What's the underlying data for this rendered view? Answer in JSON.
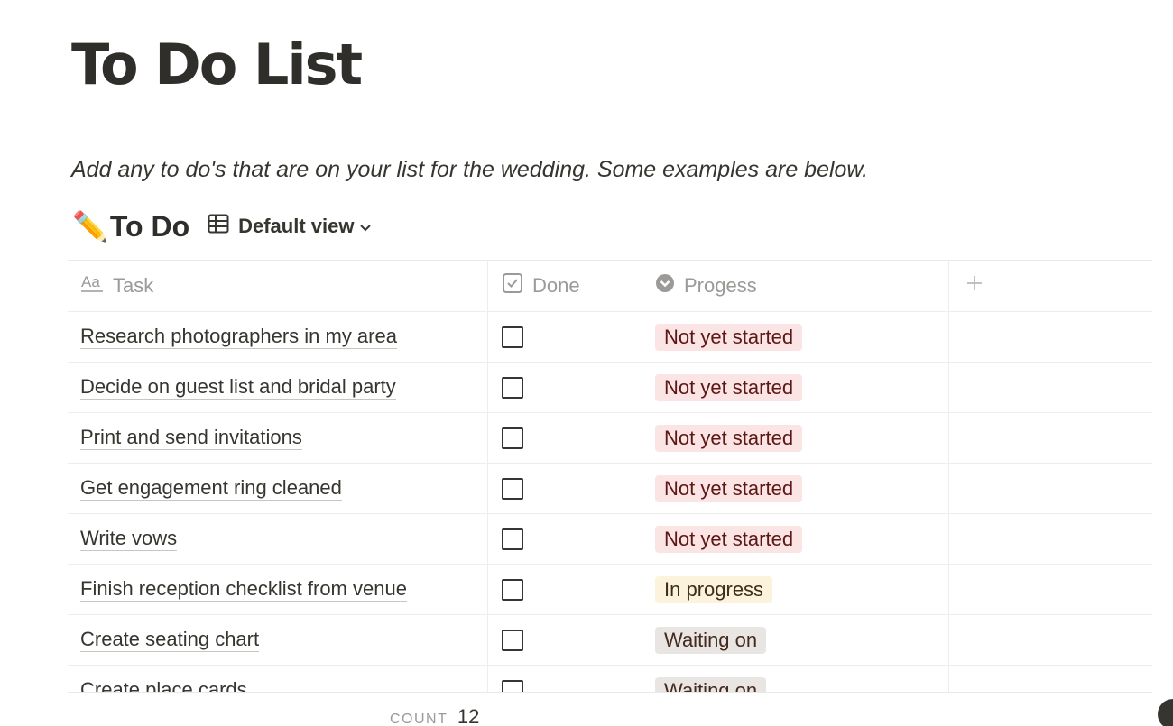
{
  "page": {
    "title": "To Do List",
    "description": "Add any to do's that are on your list for the wedding. Some examples are below."
  },
  "database": {
    "emoji": "✏️",
    "title": "To Do",
    "view_icon": "table-icon",
    "view_label": "Default view"
  },
  "columns": {
    "task": {
      "label": "Task",
      "icon": "text-property-icon",
      "icon_text": "Aa"
    },
    "done": {
      "label": "Done",
      "icon": "checkbox-property-icon"
    },
    "progress": {
      "label": "Progess",
      "icon": "select-property-icon"
    },
    "add": {
      "label": "+",
      "icon": "plus-icon"
    }
  },
  "status_colors": {
    "Not yet started": {
      "bg": "#fbe4e4",
      "fg": "#5d1715"
    },
    "In progress": {
      "bg": "#fbf3db",
      "fg": "#402c1b"
    },
    "Waiting on": {
      "bg": "#e9e5e3",
      "fg": "#442a1e"
    }
  },
  "rows": [
    {
      "task": "Research photographers in my area",
      "done": false,
      "progress": "Not yet started"
    },
    {
      "task": "Decide on guest list and bridal party",
      "done": false,
      "progress": "Not yet started"
    },
    {
      "task": "Print and send invitations",
      "done": false,
      "progress": "Not yet started"
    },
    {
      "task": "Get engagement ring cleaned",
      "done": false,
      "progress": "Not yet started"
    },
    {
      "task": "Write vows",
      "done": false,
      "progress": "Not yet started"
    },
    {
      "task": "Finish reception checklist from venue",
      "done": false,
      "progress": "In progress"
    },
    {
      "task": "Create seating chart",
      "done": false,
      "progress": "Waiting on"
    },
    {
      "task": "Create place cards",
      "done": false,
      "progress": "Waiting on"
    }
  ],
  "footer": {
    "count_label": "COUNT",
    "count_value": "12"
  }
}
